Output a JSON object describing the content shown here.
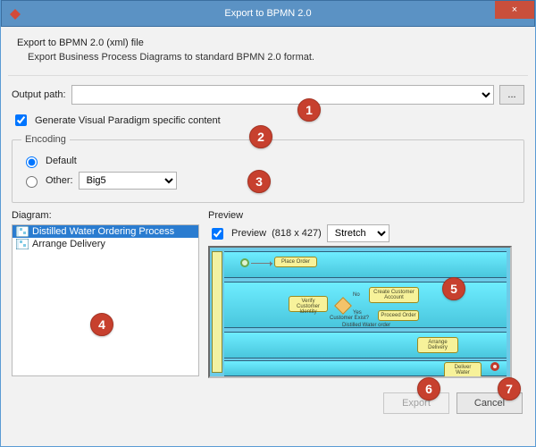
{
  "window": {
    "title": "Export to BPMN 2.0",
    "close_glyph": "×"
  },
  "intro": {
    "heading": "Export to BPMN 2.0 (xml) file",
    "sub": "Export Business Process Diagrams to standard BPMN 2.0 format."
  },
  "output_path": {
    "label": "Output path:",
    "value": "",
    "browse_label": "..."
  },
  "generate_vp": {
    "label": "Generate Visual Paradigm specific content",
    "checked": true
  },
  "encoding": {
    "legend": "Encoding",
    "default_label": "Default",
    "other_label": "Other:",
    "selected": "default",
    "other_value": "Big5"
  },
  "diagram": {
    "label": "Diagram:",
    "items": [
      {
        "label": "Distilled Water Ordering Process",
        "selected": true
      },
      {
        "label": "Arrange Delivery",
        "selected": false
      }
    ]
  },
  "preview": {
    "label": "Preview",
    "check_label": "Preview",
    "checked": true,
    "dims": "(818 x 427)",
    "size_mode": "Stretch",
    "tasks": {
      "place_order": "Place Order",
      "verify_identity": "Verify Customer Identity",
      "create_account": "Create Customer Account",
      "proceed_order": "Proceed Order",
      "arrange_delivery": "Arrange Delivery",
      "deliver_water": "Deliver Water",
      "gateway_label": "Customer Exist?",
      "yes": "Yes",
      "no": "No",
      "distilled": "Distilled Water order"
    }
  },
  "buttons": {
    "export": "Export",
    "cancel": "Cancel"
  },
  "annotations": {
    "1": "1",
    "2": "2",
    "3": "3",
    "4": "4",
    "5": "5",
    "6": "6",
    "7": "7"
  }
}
